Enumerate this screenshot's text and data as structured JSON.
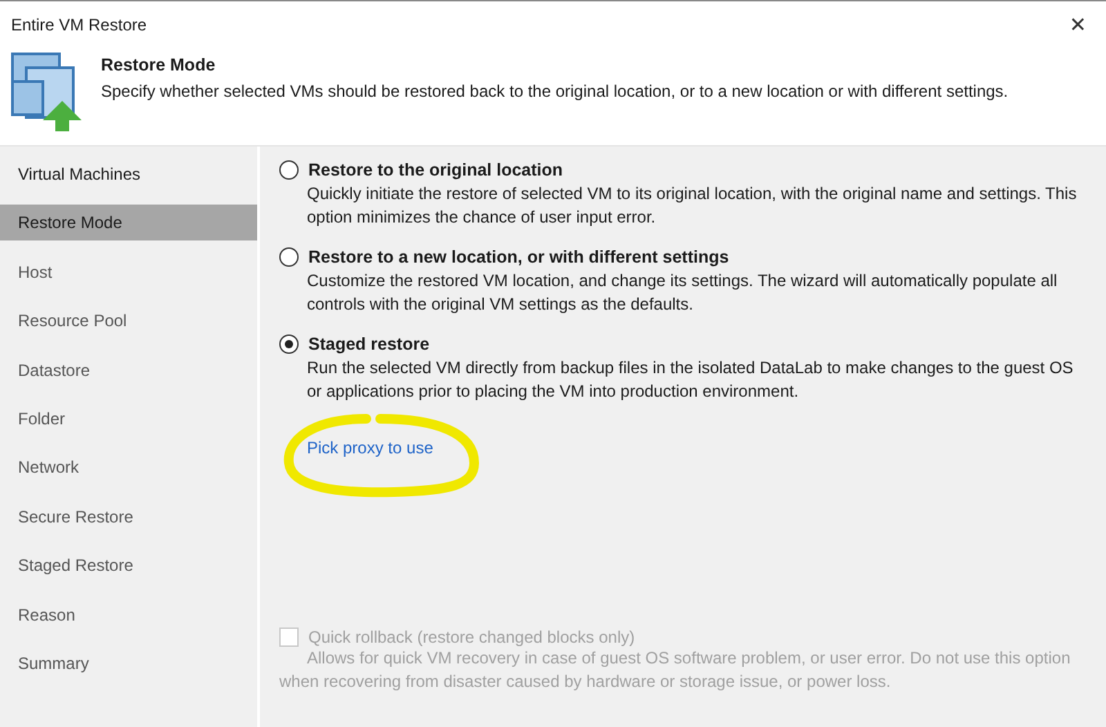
{
  "window": {
    "title": "Entire VM Restore",
    "close": "✕"
  },
  "header": {
    "title": "Restore Mode",
    "subtitle": "Specify whether selected VMs should be restored back to the original location, or to a new location or with different settings."
  },
  "sidebar": {
    "items": [
      {
        "label": "Virtual Machines",
        "selected": false
      },
      {
        "label": "Restore Mode",
        "selected": true
      },
      {
        "label": "Host",
        "selected": false
      },
      {
        "label": "Resource Pool",
        "selected": false
      },
      {
        "label": "Datastore",
        "selected": false
      },
      {
        "label": "Folder",
        "selected": false
      },
      {
        "label": "Network",
        "selected": false
      },
      {
        "label": "Secure Restore",
        "selected": false
      },
      {
        "label": "Staged Restore",
        "selected": false
      },
      {
        "label": "Reason",
        "selected": false
      },
      {
        "label": "Summary",
        "selected": false
      }
    ]
  },
  "options": [
    {
      "label": "Restore to the original location",
      "description": "Quickly initiate the restore of selected VM to its original location, with the original name and settings. This option minimizes the chance of user input error.",
      "selected": false
    },
    {
      "label": "Restore to a new location, or with different settings",
      "description": "Customize the restored VM location, and change its settings. The wizard will automatically populate all controls with the original VM settings as the defaults.",
      "selected": false
    },
    {
      "label": "Staged restore",
      "description": "Run the selected VM directly from backup files in the isolated DataLab to make changes to the guest OS or applications prior to placing the VM into production environment.",
      "selected": true
    }
  ],
  "proxy_link": "Pick proxy to use",
  "quick_rollback": {
    "label": "Quick rollback (restore changed blocks only)",
    "description": "Allows for quick VM recovery in case of guest OS software problem, or user error. Do not use this option when recovering from disaster caused by hardware or storage issue, or power loss.",
    "checked": false,
    "disabled": true
  }
}
